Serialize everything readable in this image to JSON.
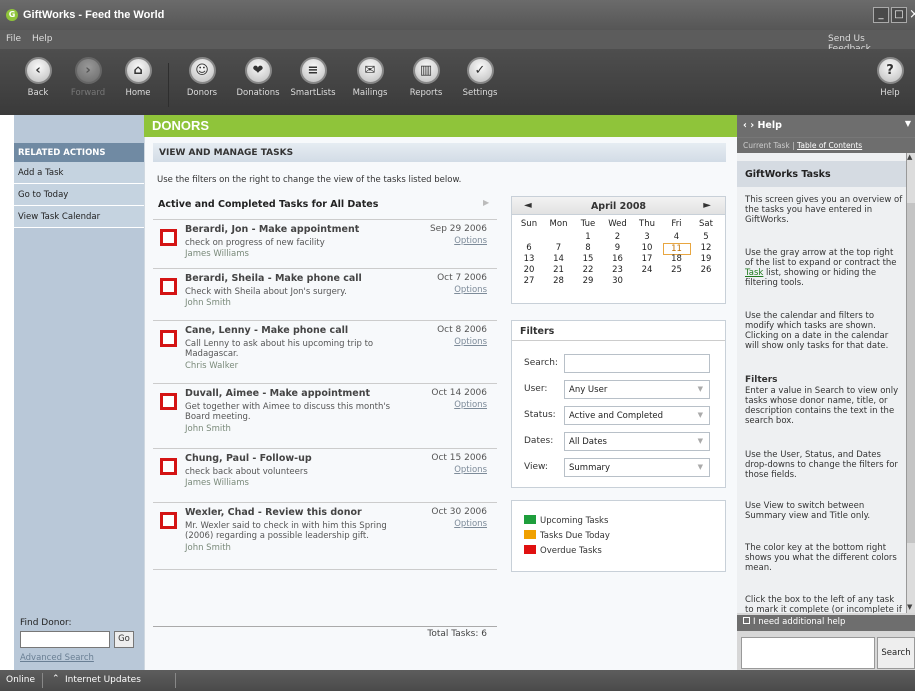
{
  "window": {
    "title": "GiftWorks - Feed the World",
    "logo_glyph": "G"
  },
  "menu": {
    "items": [
      "File",
      "Help"
    ],
    "feedback": "Send Us Feedback..."
  },
  "toolbar": {
    "back": "Back",
    "forward": "Forward",
    "home": "Home",
    "donors": "Donors",
    "donations": "Donations",
    "smartlists": "SmartLists",
    "mailings": "Mailings",
    "reports": "Reports",
    "settings": "Settings",
    "help": "Help"
  },
  "left": {
    "header": "RELATED ACTIONS",
    "items": [
      "Add a Task",
      "Go to Today",
      "View Task Calendar"
    ],
    "find_label": "Find Donor:",
    "find_value": "",
    "go": "Go",
    "advanced": "Advanced Search"
  },
  "page": {
    "title": "DONORS",
    "section": "VIEW AND MANAGE TASKS",
    "intro": "Use the filters on the right to change the view of the tasks listed below."
  },
  "tasks": {
    "heading": "Active and Completed Tasks for All Dates",
    "options_label": "Options",
    "total": "Total Tasks: 6",
    "items": [
      {
        "name": "Berardi, Jon - Make appointment",
        "date": "Sep 29 2006",
        "desc": "check on progress of new facility",
        "person": "James Williams"
      },
      {
        "name": "Berardi, Sheila - Make phone call",
        "date": "Oct 7 2006",
        "desc": "Check with Sheila about Jon's surgery.",
        "person": "John Smith"
      },
      {
        "name": "Cane, Lenny - Make phone call",
        "date": "Oct 8 2006",
        "desc": "Call Lenny to ask about his upcoming trip to Madagascar.",
        "person": "Chris Walker"
      },
      {
        "name": "Duvall, Aimee - Make appointment",
        "date": "Oct 14 2006",
        "desc": "Get together with Aimee to discuss this month's Board meeting.",
        "person": "John Smith"
      },
      {
        "name": "Chung, Paul - Follow-up",
        "date": "Oct 15 2006",
        "desc": "check back about volunteers",
        "person": "James Williams"
      },
      {
        "name": "Wexler, Chad - Review this donor",
        "date": "Oct 30 2006",
        "desc": "Mr. Wexler said to check in with him this Spring (2006) regarding a possible leadership gift.",
        "person": "John Smith"
      }
    ]
  },
  "calendar": {
    "month": "April 2008",
    "prev": "◄",
    "next": "►",
    "weekdays": [
      "Sun",
      "Mon",
      "Tue",
      "Wed",
      "Thu",
      "Fri",
      "Sat"
    ],
    "first_weekday": 2,
    "days_in_month": 30,
    "today": 11
  },
  "filters": {
    "header": "Filters",
    "search_label": "Search:",
    "search_value": "",
    "user_label": "User:",
    "user_value": "Any User",
    "status_label": "Status:",
    "status_value": "Active and Completed",
    "dates_label": "Dates:",
    "dates_value": "All Dates",
    "view_label": "View:",
    "view_value": "Summary"
  },
  "legend": [
    {
      "label": "Upcoming Tasks",
      "color": "#1e9e3c"
    },
    {
      "label": "Tasks Due Today",
      "color": "#f0a000"
    },
    {
      "label": "Overdue Tasks",
      "color": "#e01010"
    }
  ],
  "helppane": {
    "header": "Help",
    "current": "Current Task",
    "toc": "Table of Contents",
    "title": "GiftWorks Tasks",
    "p1": "This screen gives you an overview of the tasks you have entered in GiftWorks.",
    "p2a": "Use the gray arrow at the top right of the list to expand or contract the ",
    "p2link": "Task",
    "p2b": " list, showing or hiding the filtering tools.",
    "p3": "Use the calendar and filters to modify which tasks are shown. Clicking on a date in the calendar will show only tasks for that date.",
    "filters_title": "Filters",
    "p4": "Enter a value in Search to view only tasks whose donor name, title, or description contains the text in the search box.",
    "p5": "Use the User, Status, and Dates drop-downs to change the filters for those fields.",
    "p6": "Use View to switch between Summary view and Title only.",
    "p7": "The color key at the bottom right shows you what the different colors mean.",
    "p8": "Click the box to the left of any task to mark it complete (or incomplete if",
    "need_help": "I need additional help",
    "search_btn": "Search"
  },
  "status": {
    "online": "Online",
    "updates": "Internet Updates"
  }
}
